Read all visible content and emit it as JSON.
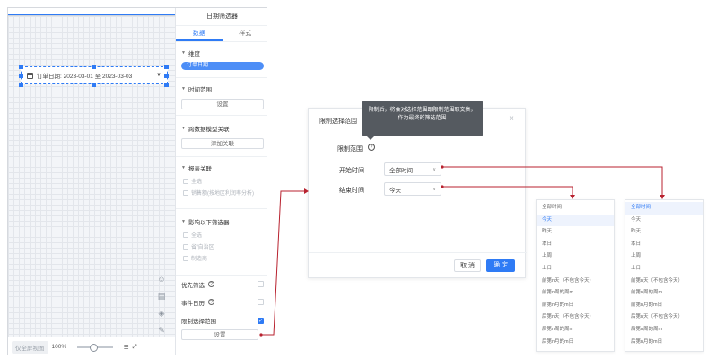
{
  "canvas": {
    "date_widget_text": "订单日期: 2023-03-01 至 2023-03-03"
  },
  "bottom_bar": {
    "ghost_label": "仅全屏视图",
    "zoom": "100%",
    "minus": "−",
    "plus": "+"
  },
  "panel": {
    "title": "日期筛选器",
    "tabs": [
      "数据",
      "样式"
    ],
    "dimension": {
      "title": "维度",
      "field": "订单日期"
    },
    "time_range": {
      "title": "时间范围",
      "button": "设置"
    },
    "cross_model": {
      "title": "跨数据模型关联",
      "button": "添加关联"
    },
    "report_link": {
      "title": "报表关联",
      "select_all": "全选",
      "item": "销售额(按地区利润率分析)"
    },
    "affect_filters": {
      "title": "影响以下筛选器",
      "select_all": "全选",
      "item1": "省/自治区",
      "item2": "制造商"
    },
    "priority_filter": "优先筛选",
    "event_calendar": "事件日历",
    "limit_range": "限制选择范围",
    "limit_button": "设置",
    "check_mark": "✓",
    "help_glyph": "?"
  },
  "dialog": {
    "title": "限制选择范围",
    "close_glyph": "×",
    "section_label": "限制范围",
    "start_label": "开始时间",
    "start_value": "全部时间",
    "end_label": "结束时间",
    "end_value": "今天",
    "cancel": "取 消",
    "ok": "确 定"
  },
  "tooltip": {
    "text": "限制后，将会对选择范围跟限制范围取交集，作为最终的筛选范围"
  },
  "dropdown_end": {
    "items": [
      "全部时间",
      "今天",
      "昨天",
      "本日",
      "上周",
      "上日",
      "前第n天（不包含今天）",
      "前第n周的周m",
      "前第n月的m日",
      "后第n天（不包含今天）",
      "后第n周的周m",
      "后第n月的m日"
    ],
    "selected_index": 1
  },
  "dropdown_start": {
    "items": [
      "全部时间",
      "今天",
      "昨天",
      "本日",
      "上周",
      "上日",
      "前第n天（不包含今天）",
      "前第n周的周m",
      "前第n月的m日",
      "后第n天（不包含今天）",
      "后第n周的周m",
      "后第n月的m日"
    ],
    "selected_index": 0
  },
  "colors": {
    "accent": "#2f7bf5",
    "connector": "#b8222f",
    "tooltip_bg": "#555a60"
  }
}
